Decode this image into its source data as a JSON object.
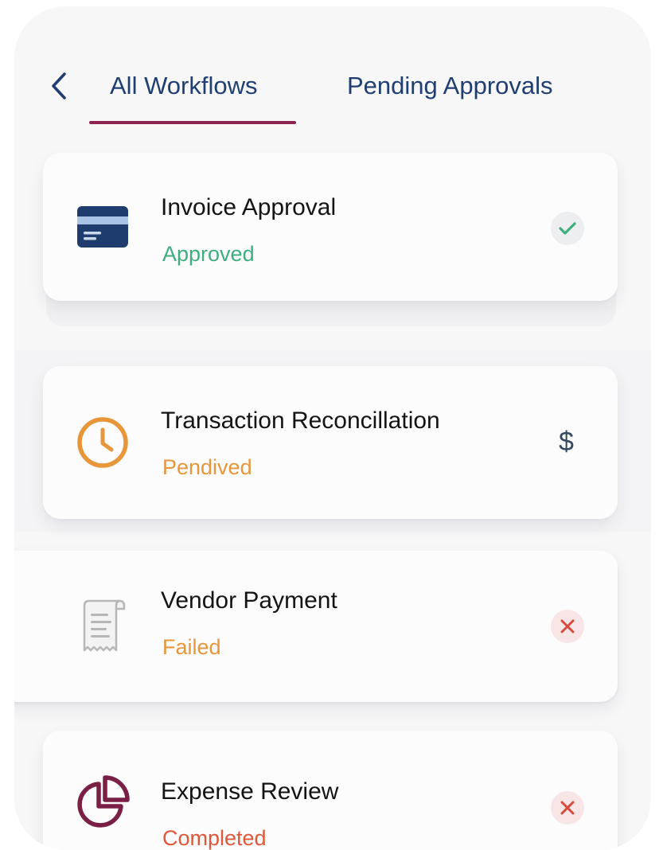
{
  "header": {
    "back_icon": "chevron-left-icon",
    "tabs": [
      {
        "label": "All Workflows",
        "active": true
      },
      {
        "label": "Pending Approvals",
        "active": false
      }
    ],
    "accent_color": "#8c2452",
    "tab_color": "#1f3f72"
  },
  "workflows": [
    {
      "title": "Invoice Approval",
      "status": "Approved",
      "status_color": "#3fae7f",
      "icon": "credit-card-icon",
      "badge_icon": "check-icon"
    },
    {
      "title": "Transaction Reconcillation",
      "status": "Pendived",
      "status_color": "#e8963a",
      "icon": "clock-icon",
      "badge_icon": "dollar-icon",
      "badge_text": "$"
    },
    {
      "title": "Vendor Payment",
      "status": "Failed",
      "status_color": "#e8963a",
      "icon": "receipt-icon",
      "badge_icon": "close-icon"
    },
    {
      "title": "Expense Review",
      "status": "Completed",
      "status_color": "#e0573a",
      "icon": "pie-chart-icon",
      "badge_icon": "close-icon"
    }
  ]
}
